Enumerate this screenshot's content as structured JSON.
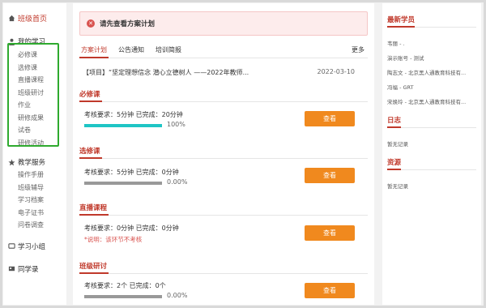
{
  "sidebar": {
    "home_label": "班级首页",
    "my_study_label": "我的学习",
    "my_study_items": [
      "必修课",
      "选修课",
      "直播课程",
      "班级研讨",
      "作业",
      "研修成果",
      "试卷",
      "研修活动"
    ],
    "teaching_service_label": "教学服务",
    "teaching_service_items": [
      "操作手册",
      "班级辅导",
      "学习档案",
      "电子证书",
      "问卷调查"
    ],
    "study_group_label": "学习小组",
    "classmates_label": "同学录"
  },
  "main": {
    "alert_text": "请先查看方案计划",
    "tabs": [
      "方案计划",
      "公告通知",
      "培训简报"
    ],
    "more_label": "更多",
    "project_title": "【项目】“坚定理想信念 潜心立德树人 ——2022年教师...",
    "project_date": "2022-03-10",
    "sections": [
      {
        "title": "必修课",
        "requirement": "考核要求：5分钟 已完成：20分钟",
        "progress": 1.0,
        "percent_label": "100%",
        "button": "查看",
        "note": ""
      },
      {
        "title": "选修课",
        "requirement": "考核要求：5分钟 已完成：0分钟",
        "progress": 0.0,
        "percent_label": "0.00%",
        "button": "查看",
        "note": ""
      },
      {
        "title": "直播课程",
        "requirement": "考核要求：0分钟 已完成：0分钟",
        "progress": 0.0,
        "percent_label": "0.00%",
        "button": "查看",
        "note": "*说明：该环节不考核"
      },
      {
        "title": "班级研讨",
        "requirement": "考核要求：2个 已完成：0个",
        "progress": 0.0,
        "percent_label": "0.00%",
        "button": "查看",
        "note": ""
      }
    ]
  },
  "right": {
    "latest_students_title": "最新学员",
    "latest_students": [
      "韦丽 - .",
      "演示账号 - 测试",
      "陶志文 - 北京黑人通教育科技有...",
      "冯福 - GRT",
      "宋焕玲 - 北京黑人通教育科技有..."
    ],
    "log_title": "日志",
    "log_empty": "暂无记录",
    "resource_title": "资源",
    "resource_empty": "暂无记录"
  },
  "colors": {
    "accent_red": "#c0392b",
    "button_orange": "#f0891e",
    "progress_cyan": "#1ec5c5",
    "highlight_green": "#2eaa2e"
  }
}
